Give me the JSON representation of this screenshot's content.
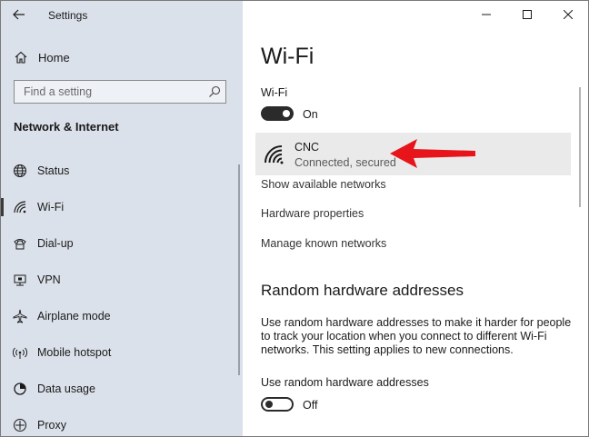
{
  "window": {
    "title": "Settings"
  },
  "sidebar": {
    "home_label": "Home",
    "search_placeholder": "Find a setting",
    "section_title": "Network & Internet",
    "items": [
      {
        "label": "Status",
        "icon": "globe-icon"
      },
      {
        "label": "Wi-Fi",
        "icon": "wifi-icon",
        "active": true
      },
      {
        "label": "Dial-up",
        "icon": "dialup-icon"
      },
      {
        "label": "VPN",
        "icon": "vpn-icon"
      },
      {
        "label": "Airplane mode",
        "icon": "airplane-icon"
      },
      {
        "label": "Mobile hotspot",
        "icon": "hotspot-icon"
      },
      {
        "label": "Data usage",
        "icon": "data-usage-icon"
      },
      {
        "label": "Proxy",
        "icon": "proxy-icon"
      }
    ]
  },
  "main": {
    "title": "Wi-Fi",
    "wifi_toggle_label": "Wi-Fi",
    "wifi_toggle_state": "On",
    "network": {
      "name": "CNC",
      "status": "Connected, secured"
    },
    "links": [
      "Show available networks",
      "Hardware properties",
      "Manage known networks"
    ],
    "random_section_title": "Random hardware addresses",
    "random_description": "Use random hardware addresses to make it harder for people to track your location when you connect to different Wi-Fi networks. This setting applies to new connections.",
    "random_toggle_label": "Use random hardware addresses",
    "random_toggle_state": "Off"
  },
  "colors": {
    "sidebar_bg": "#dbe1ea",
    "toggle_dark": "#2b2b2b",
    "annotation_arrow": "#e8141b"
  }
}
